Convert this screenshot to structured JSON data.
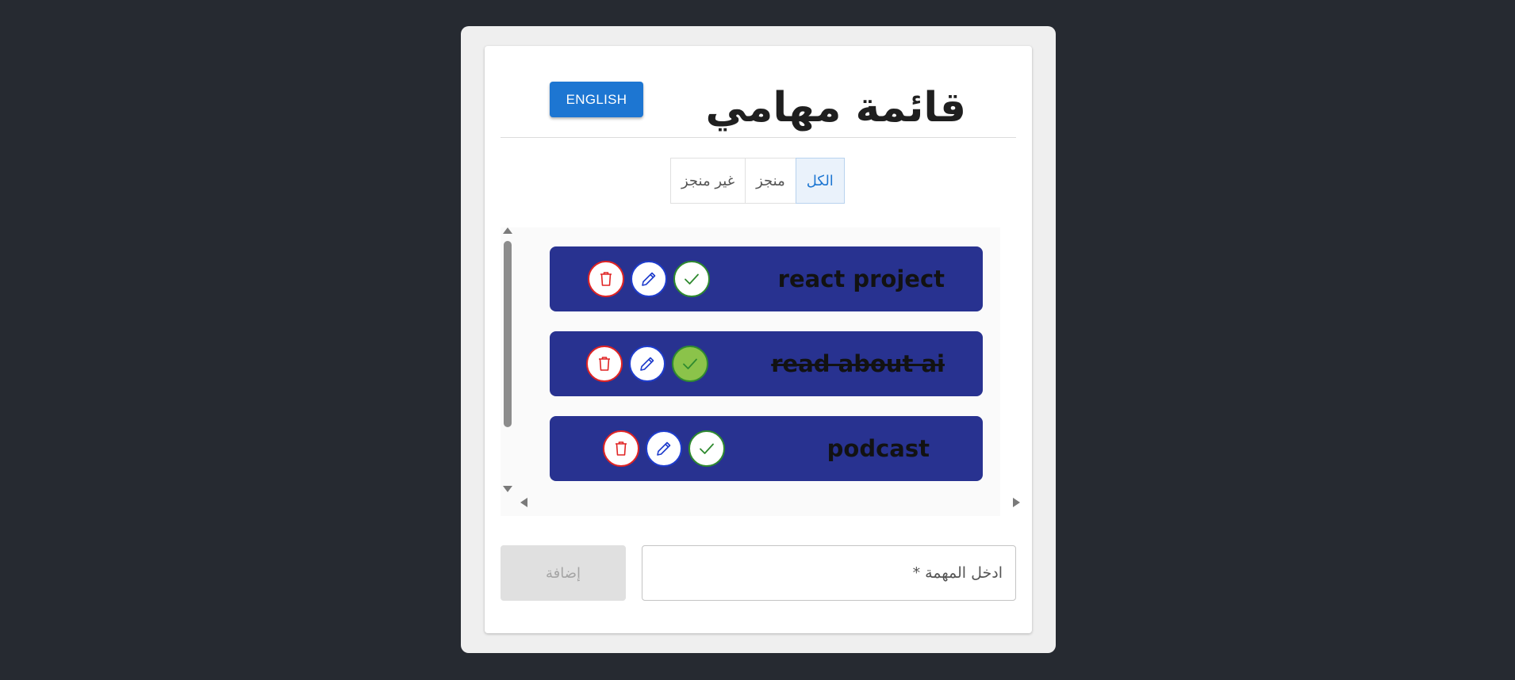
{
  "header": {
    "title": "قائمة مهامي",
    "language_button": "ENGLISH"
  },
  "filters": [
    {
      "label": "الكل",
      "active": true
    },
    {
      "label": "منجز",
      "active": false
    },
    {
      "label": "غير منجز",
      "active": false
    }
  ],
  "tasks": [
    {
      "title": "react project",
      "done": false
    },
    {
      "title": "read about ai",
      "done": true
    },
    {
      "title": "podcast",
      "done": false
    }
  ],
  "form": {
    "add_button": "إضافة",
    "input_placeholder": "ادخل المهمة *",
    "input_value": ""
  },
  "colors": {
    "page_background": "#262a31",
    "task_background": "#283290",
    "accent": "#1d76d2",
    "delete": "#e02424",
    "edit": "#1e3ccc",
    "check": "#2f8a2f",
    "check_done_fill": "#8bc34a"
  },
  "icons": {
    "delete": "trash-icon",
    "edit": "pencil-icon",
    "complete": "check-icon"
  }
}
